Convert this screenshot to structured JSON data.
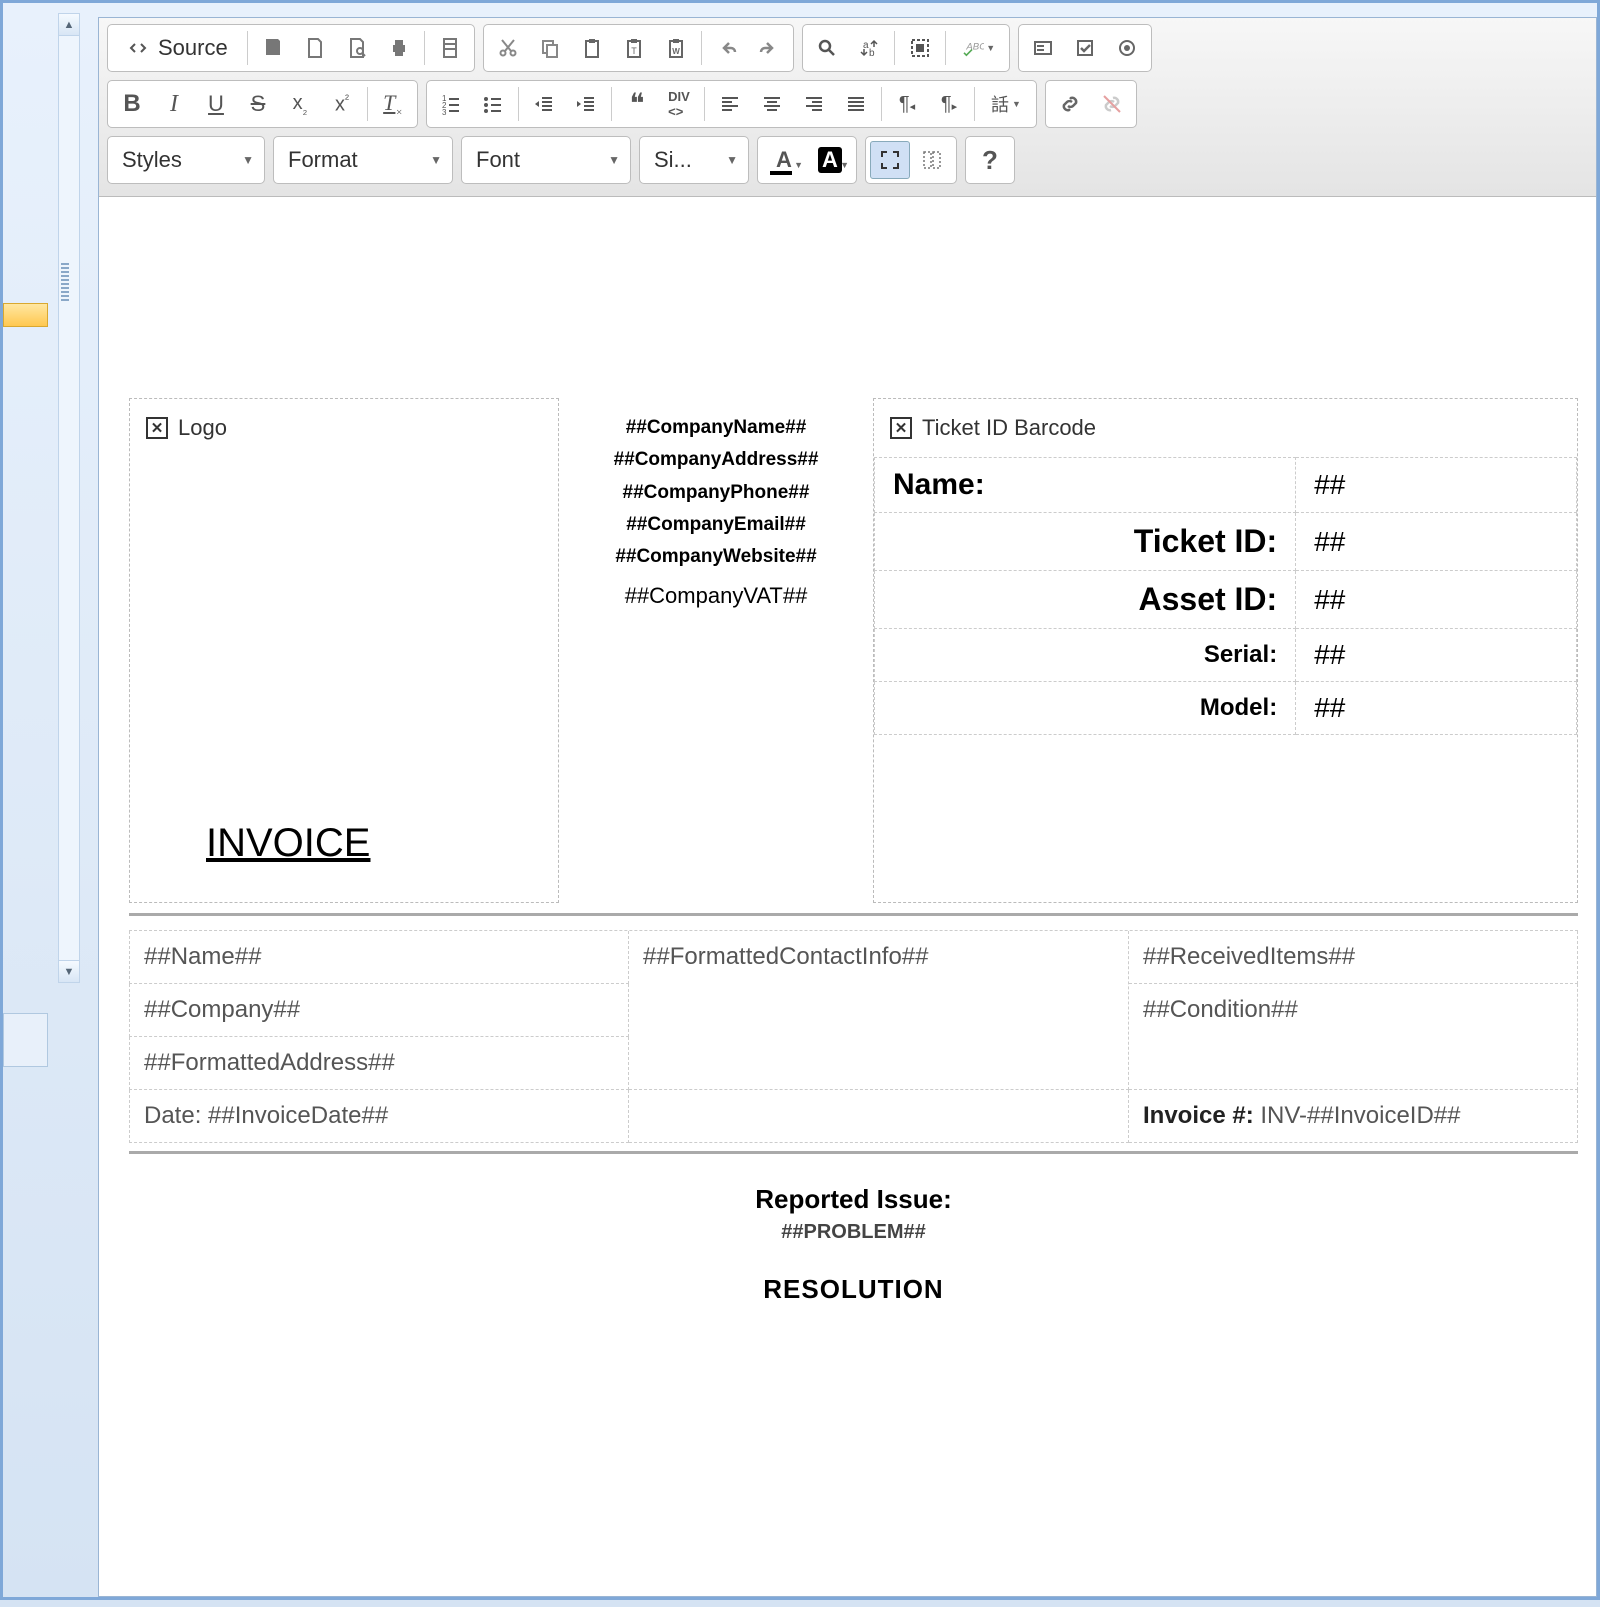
{
  "toolbar": {
    "source_label": "Source",
    "styles_label": "Styles",
    "format_label": "Format",
    "font_label": "Font",
    "size_label": "Si..."
  },
  "header": {
    "logo_label": "Logo",
    "company_name": "##CompanyName##",
    "company_address": "##CompanyAddress##",
    "company_phone": "##CompanyPhone##",
    "company_email": "##CompanyEmail##",
    "company_website": "##CompanyWebsite##",
    "company_vat": "##CompanyVAT##",
    "barcode_label": "Ticket ID Barcode"
  },
  "ticket": {
    "name_label": "Name:",
    "name_val": "##",
    "ticket_label": "Ticket ID:",
    "ticket_val": "##",
    "asset_label": "Asset ID:",
    "asset_val": "##",
    "serial_label": "Serial:",
    "serial_val": "##",
    "model_label": "Model:",
    "model_val": "##"
  },
  "title": "INVOICE",
  "info": {
    "name": "##Name##",
    "company": "##Company##",
    "address": "##FormattedAddress##",
    "date_prefix": "Date: ",
    "date_val": "##InvoiceDate##",
    "contact": "##FormattedContactInfo##",
    "received": "##ReceivedItems##",
    "condition": "##Condition##",
    "invoice_label": "Invoice #: ",
    "invoice_val": "INV-##InvoiceID##"
  },
  "issue": {
    "heading": "Reported Issue:",
    "problem": "##PROBLEM##",
    "resolution": "RESOLUTION"
  }
}
